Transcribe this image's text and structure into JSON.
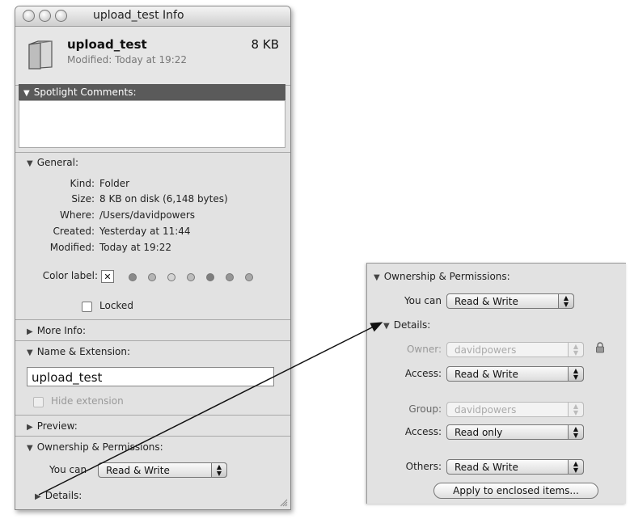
{
  "window": {
    "title": "upload_test Info",
    "file_name": "upload_test",
    "file_size": "8 KB",
    "modified_line": "Modified: Today at 19:22"
  },
  "spotlight": {
    "heading": "Spotlight Comments:"
  },
  "general": {
    "heading": "General:",
    "rows": [
      {
        "label": "Kind:",
        "value": "Folder"
      },
      {
        "label": "Size:",
        "value": "8 KB on disk (6,148 bytes)"
      },
      {
        "label": "Where:",
        "value": "/Users/davidpowers"
      },
      {
        "label": "Created:",
        "value": "Yesterday at 11:44"
      },
      {
        "label": "Modified:",
        "value": "Today at 19:22"
      }
    ],
    "color_label": "Color label:",
    "locked_label": "Locked"
  },
  "more_info": {
    "heading": "More Info:"
  },
  "name_ext": {
    "heading": "Name & Extension:",
    "value": "upload_test",
    "hide_ext_label": "Hide extension"
  },
  "preview": {
    "heading": "Preview:"
  },
  "ownership": {
    "heading": "Ownership & Permissions:",
    "you_can_label": "You can",
    "you_can_value": "Read & Write",
    "details_label": "Details:"
  },
  "panel": {
    "heading": "Ownership & Permissions:",
    "you_can_label": "You can",
    "you_can_value": "Read & Write",
    "details_label": "Details:",
    "owner_label": "Owner:",
    "owner_value": "davidpowers",
    "owner_access_label": "Access:",
    "owner_access_value": "Read & Write",
    "group_label": "Group:",
    "group_value": "davidpowers",
    "group_access_label": "Access:",
    "group_access_value": "Read only",
    "others_label": "Others:",
    "others_value": "Read & Write",
    "apply_label": "Apply to enclosed items..."
  },
  "icons": {
    "folder": "folder-icon",
    "lock": "lock-icon",
    "disclosure_open": "▼",
    "disclosure_closed": "▶",
    "stepper": "⌃⌄"
  },
  "colors": {
    "label_dots": [
      "#8a8a8a",
      "#b5b5b5",
      "#d4d4d4",
      "#bdbdbd",
      "#7e7e7e",
      "#969696",
      "#a9a9a9"
    ]
  }
}
